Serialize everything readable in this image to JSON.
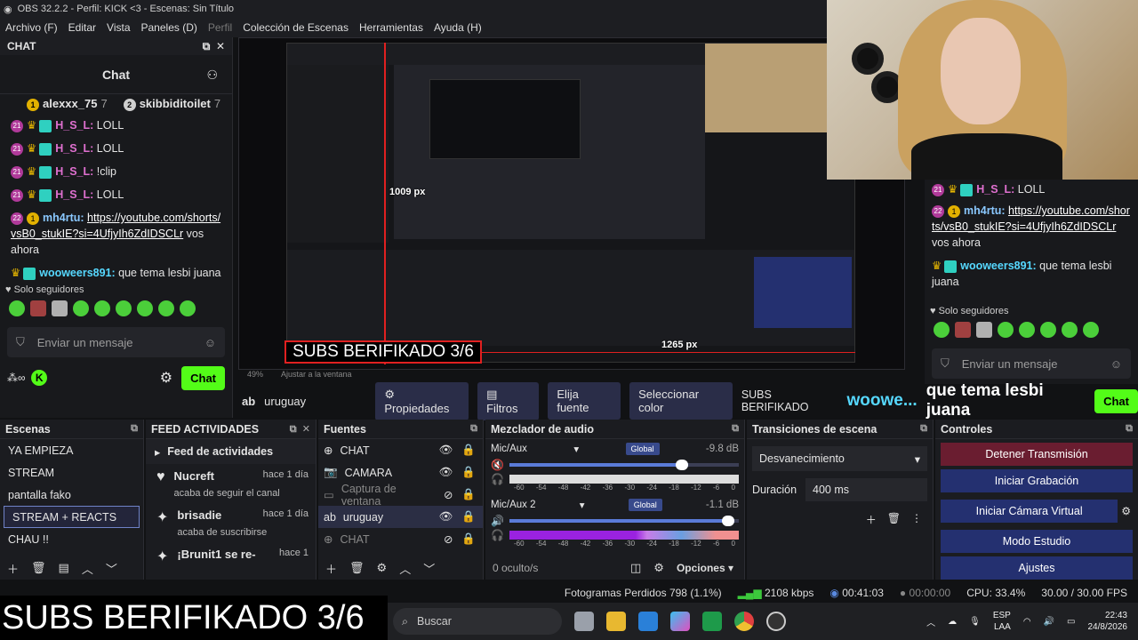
{
  "window": {
    "title": "OBS 32.2.2 - Perfil: KICK <3 - Escenas: Sin Título"
  },
  "menu": [
    "Archivo (F)",
    "Editar",
    "Vista",
    "Paneles (D)",
    "Perfil",
    "Colección de Escenas",
    "Herramientas",
    "Ayuda (H)"
  ],
  "chat": {
    "dock_label": "CHAT",
    "title": "Chat",
    "gifters": [
      {
        "name": "alexxx_75",
        "count": "7"
      },
      {
        "name": "skibbiditoilet",
        "count": "7"
      }
    ],
    "messages": [
      {
        "user": "H_S_L",
        "text": "LOLL",
        "sub": "21"
      },
      {
        "user": "H_S_L",
        "text": "LOLL",
        "sub": "21"
      },
      {
        "user": "H_S_L",
        "text": "!clip",
        "sub": "21"
      },
      {
        "user": "H_S_L",
        "text": "LOLL",
        "sub": "21"
      }
    ],
    "mh_user": "mh4rtu",
    "mh_sub": "22",
    "mh_link": "https://youtube.com/shorts/vsB0_stukIE?si=4UfjyIh6ZdIDSCLr",
    "mh_text": "vos ahora",
    "woo_user": "wooweers891",
    "woo_text": "que tema lesbi juana",
    "followers": "Solo seguidores",
    "placeholder": "Enviar un mensaje",
    "send": "Chat"
  },
  "preview": {
    "measure_h": "1009 px",
    "measure_w": "1265 px",
    "subs_text": "SUBS BERIFIKADO 3/6",
    "zoom": "49%",
    "fit": "Ajustar a la ventana"
  },
  "toolbar": {
    "source": "uruguay",
    "props": "Propiedades",
    "filters": "Filtros",
    "pick": "Elija fuente",
    "color": "Seleccionar color",
    "overlay": "SUBS BERIFIKADO",
    "overlay2": "woowe...",
    "overlay3": "que tema lesbi juana",
    "chat_btn": "Chat"
  },
  "scenes": {
    "title": "Escenas",
    "items": [
      "YA EMPIEZA",
      "STREAM",
      "pantalla fako",
      "STREAM + REACTS",
      "CHAU !!"
    ],
    "selected": 3
  },
  "feed": {
    "title": "FEED ACTIVIDADES",
    "heading": "Feed de actividades",
    "items": [
      {
        "user": "Nucreft",
        "time": "hace 1 día",
        "text": "acaba de seguir el canal"
      },
      {
        "user": "brisadie",
        "time": "hace 1 día",
        "text": "acaba de suscribirse"
      },
      {
        "user": "¡Brunit1 se re-",
        "time": "hace 1",
        "text": ""
      }
    ]
  },
  "sources": {
    "title": "Fuentes",
    "items": [
      {
        "name": "CHAT",
        "state": "on"
      },
      {
        "name": "CAMARA",
        "state": "on"
      },
      {
        "name": "Captura de ventana",
        "state": "off"
      },
      {
        "name": "uruguay",
        "state": "sel"
      },
      {
        "name": "CHAT",
        "state": "off"
      }
    ]
  },
  "mixer": {
    "title": "Mezclador de audio",
    "channels": [
      {
        "name": "Mic/Aux",
        "db": "-9.8 dB",
        "global": "Global",
        "volume": 0.78,
        "muted": true
      },
      {
        "name": "Mic/Aux 2",
        "db": "-1.1 dB",
        "global": "Global",
        "volume": 0.98,
        "muted": false
      }
    ],
    "scale": [
      "-60",
      "-54",
      "-48",
      "-42",
      "-36",
      "-30",
      "-24",
      "-18",
      "-12",
      "-6",
      "0"
    ],
    "hidden": "0 oculto/s",
    "options": "Opciones"
  },
  "transitions": {
    "title": "Transiciones de escena",
    "selected": "Desvanecimiento",
    "duration_label": "Duración",
    "duration": "400 ms"
  },
  "controls": {
    "title": "Controles",
    "buttons": [
      "Detener Transmisión",
      "Iniciar Grabación",
      "Iniciar Cámara Virtual",
      "Modo Estudio",
      "Ajustes"
    ]
  },
  "status": {
    "dropped": "Fotogramas Perdidos 798 (1.1%)",
    "bitrate": "2108 kbps",
    "stream_time": "00:41:03",
    "rec_time": "00:00:00",
    "cpu": "CPU: 33.4%",
    "fps": "30.00 / 30.00 FPS"
  },
  "subs_overlay": "SUBS BERIFIKADO 3/6",
  "taskbar": {
    "search": "Buscar",
    "lang": "ESP",
    "lang2": "LAA",
    "time": "22:43",
    "date": "24/8/2026"
  }
}
